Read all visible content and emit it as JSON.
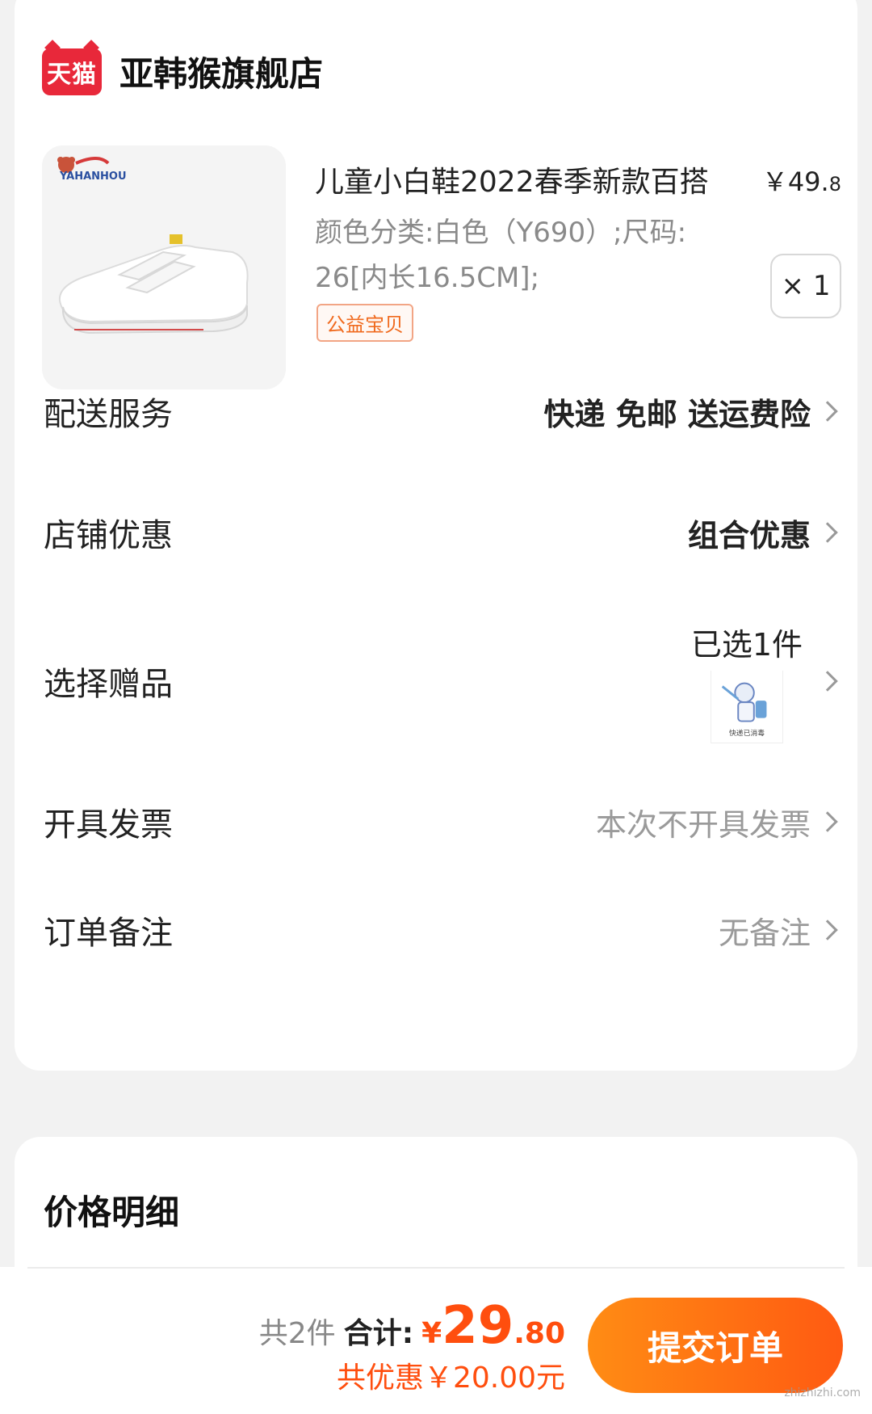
{
  "store": {
    "logo_text": "天猫",
    "name": "亚韩猴旗舰店"
  },
  "product": {
    "brand_text": "YAHANHOU",
    "title": "儿童小白鞋2022春季新款百搭",
    "price_main": "￥49.",
    "price_decimal": "8",
    "spec": "颜色分类:白色（Y690）;尺码: 26[内长16.5CM];",
    "tag": "公益宝贝",
    "quantity": "× 1"
  },
  "rows": {
    "delivery": {
      "label": "配送服务",
      "value": "快递 免邮 送运费险"
    },
    "discount": {
      "label": "店铺优惠",
      "value": "组合优惠"
    },
    "gift": {
      "label": "选择赠品",
      "value": "已选1件",
      "thumb_caption": "快递已消毒"
    },
    "invoice": {
      "label": "开具发票",
      "value": "本次不开具发票"
    },
    "note": {
      "label": "订单备注",
      "value": "无备注"
    }
  },
  "price_detail": {
    "title": "价格明细"
  },
  "summary": {
    "count": "共2件",
    "total_label": "合计:",
    "currency": "¥",
    "total_int": "29",
    "total_dec": ".80",
    "savings": "共优惠￥20.00元",
    "submit_label": "提交订单"
  },
  "watermark": "zhizhizhi.com",
  "colors": {
    "accent": "#ff4e0e",
    "button_start": "#ff8c14",
    "button_end": "#ff5a12",
    "tmall_red": "#e8283a"
  }
}
